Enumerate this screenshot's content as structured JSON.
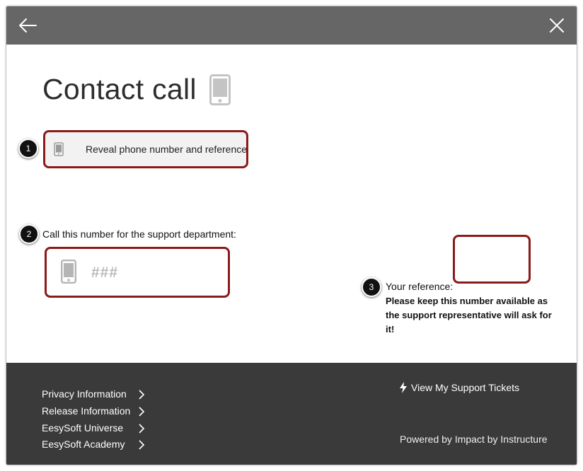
{
  "header": {
    "back_icon": "arrow-left-icon",
    "close_icon": "close-icon",
    "bar_color": "#666666"
  },
  "main": {
    "title": "Contact call",
    "title_icon": "mobile-phone-icon",
    "reveal_button": {
      "label": "Reveal phone number and reference",
      "icon": "mobile-phone-icon"
    },
    "call_label": "Call this number for the support department:",
    "phone_number": "###",
    "reference_label": "Your reference:",
    "reference_value": "",
    "reference_note": "Please keep this number available as the support representative will ask for it!"
  },
  "callouts": [
    "1",
    "2",
    "3"
  ],
  "footer": {
    "links": [
      {
        "label": "Privacy Information"
      },
      {
        "label": "Release Information"
      },
      {
        "label": "EesySoft Universe"
      },
      {
        "label": "EesySoft Academy"
      }
    ],
    "tickets_link": "View My Support Tickets",
    "powered_by": "Powered by Impact by Instructure",
    "background": "#3a3a3a"
  },
  "colors": {
    "highlight_border": "#8b1a1a",
    "callout_badge": "#111111"
  }
}
